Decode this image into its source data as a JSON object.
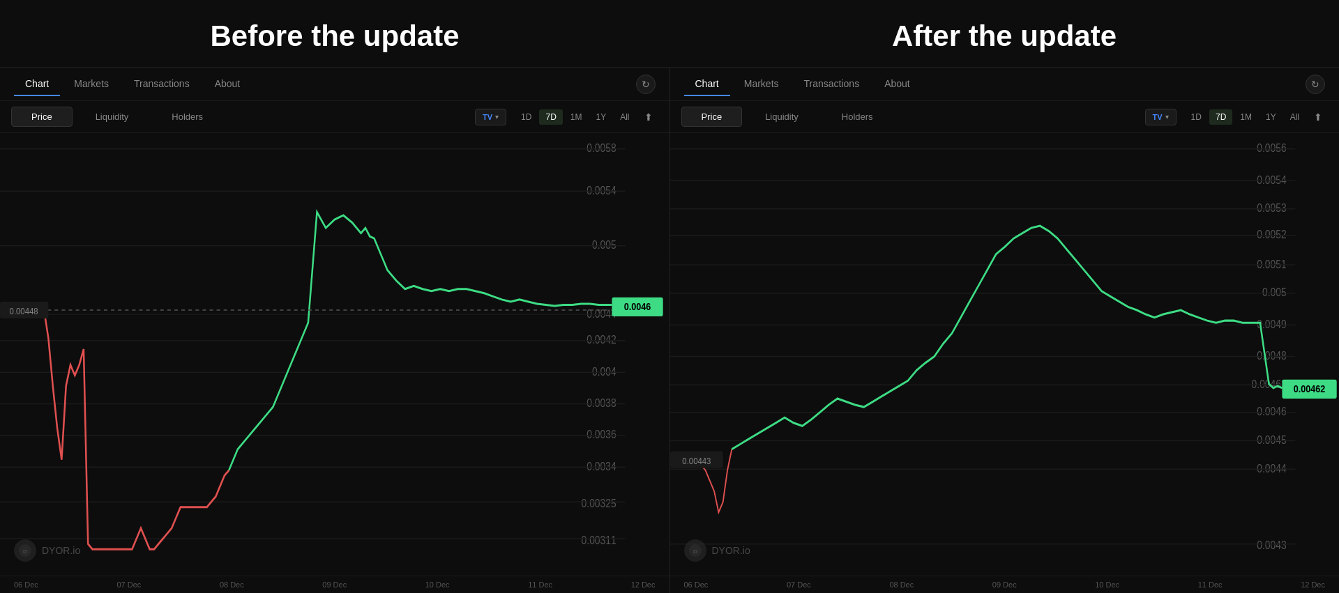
{
  "before": {
    "title": "Before the update",
    "nav": {
      "tabs": [
        "Chart",
        "Markets",
        "Transactions",
        "About"
      ],
      "active": "Chart"
    },
    "subNav": {
      "tabs": [
        "Price",
        "Liquidity",
        "Holders"
      ],
      "active": "Price",
      "timeframes": [
        "1D",
        "7D",
        "1M",
        "1Y",
        "All"
      ],
      "activeTimeframe": "7D"
    },
    "watermark": "DYOR.io",
    "xLabels": [
      "06 Dec",
      "07 Dec",
      "08 Dec",
      "09 Dec",
      "10 Dec",
      "11 Dec",
      "12 Dec"
    ],
    "yLabels": [
      "0.0058",
      "0.0054",
      "0.005",
      "0.0044",
      "0.0042",
      "0.004",
      "0.0038",
      "0.0036",
      "0.0034",
      "0.00325",
      "0.00311"
    ],
    "currentPrice": "0.0046",
    "startPrice": "0.00448"
  },
  "after": {
    "title": "After the update",
    "nav": {
      "tabs": [
        "Chart",
        "Markets",
        "Transactions",
        "About"
      ],
      "active": "Chart"
    },
    "subNav": {
      "tabs": [
        "Price",
        "Liquidity",
        "Holders"
      ],
      "active": "Price",
      "timeframes": [
        "1D",
        "7D",
        "1M",
        "1Y",
        "All"
      ],
      "activeTimeframe": "7D"
    },
    "watermark": "DYOR.io",
    "xLabels": [
      "06 Dec",
      "07 Dec",
      "08 Dec",
      "09 Dec",
      "10 Dec",
      "11 Dec",
      "12 Dec"
    ],
    "yLabels": [
      "0.0056",
      "0.0054",
      "0.0053",
      "0.0052",
      "0.0051",
      "0.005",
      "0.0049",
      "0.0048",
      "0.00462",
      "0.0046",
      "0.0045",
      "0.0044",
      "0.0043"
    ],
    "currentPrice": "0.00462",
    "startPrice": "0.00443"
  },
  "icons": {
    "refresh": "↻",
    "tradingview": "TV",
    "share": "⬆"
  }
}
